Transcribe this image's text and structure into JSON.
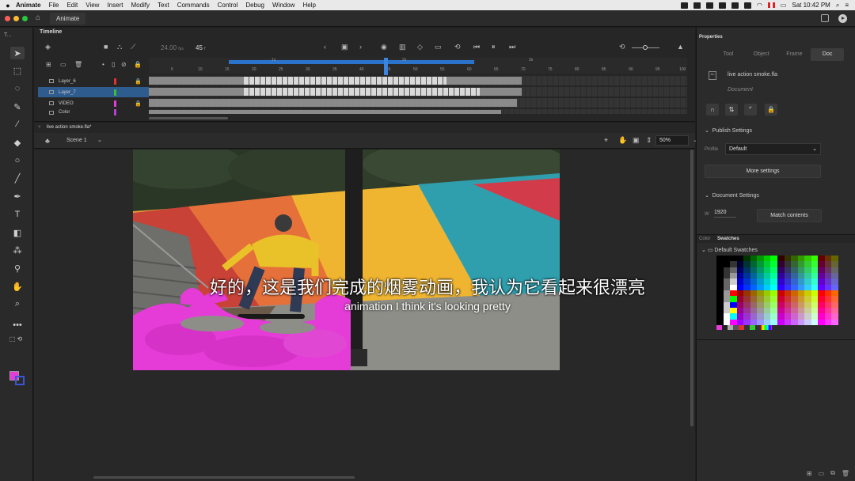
{
  "menubar": {
    "app_name": "Animate",
    "items": [
      "File",
      "Edit",
      "View",
      "Insert",
      "Modify",
      "Text",
      "Commands",
      "Control",
      "Debug",
      "Window",
      "Help"
    ],
    "clock": "Sat 10:42 PM"
  },
  "appbar": {
    "tab_label": "Animate"
  },
  "toolbar": {
    "label": "T..."
  },
  "timeline": {
    "title": "Timeline",
    "fps": "24.00",
    "fps_unit": "fps",
    "current_frame": "45",
    "frame_unit": "f",
    "ruler_ticks": [
      "5",
      "10",
      "15",
      "20",
      "25",
      "30",
      "35",
      "40",
      "45",
      "50",
      "55",
      "60",
      "65",
      "70",
      "75",
      "80",
      "85",
      "90",
      "95",
      "100"
    ],
    "marker_1s": "1s",
    "marker_2s": "2s",
    "marker_3s": "3s",
    "layers": [
      {
        "name": "Layer_6",
        "color": "#e53030",
        "locked": true,
        "selected": false
      },
      {
        "name": "Layer_7",
        "color": "#38c038",
        "locked": false,
        "selected": true
      },
      {
        "name": "VIDEO",
        "color": "#e53bd7",
        "locked": true,
        "selected": false
      },
      {
        "name": "Color",
        "color": "#b040d0",
        "locked": false,
        "selected": false
      }
    ]
  },
  "document": {
    "tab_name": "live action smoke.fla*",
    "scene": "Scene 1",
    "zoom": "50%"
  },
  "subtitles": {
    "zh": "好的，这是我们完成的烟雾动画，我认为它看起来很漂亮",
    "en": "animation I think it's looking pretty"
  },
  "properties": {
    "title": "Properties",
    "tabs": [
      "Tool",
      "Object",
      "Frame",
      "Doc"
    ],
    "active_tab": "Doc",
    "doc_name": "live action smoke.fla",
    "doc_type": "Document",
    "publish_settings": "Publish Settings",
    "profile_label": "Profile",
    "profile_value": "Default",
    "more_settings": "More settings",
    "document_settings": "Document Settings",
    "width_label": "W",
    "width_value": "1920",
    "match_contents": "Match contents",
    "color_tab": "Color",
    "swatches_tab": "Swatches",
    "swatch_group": "Default Swatches"
  },
  "colors": {
    "fill": "#e53bd7",
    "stroke": "#3a55d6",
    "selection": "#2f5c8f",
    "accent": "#2b74cc"
  }
}
